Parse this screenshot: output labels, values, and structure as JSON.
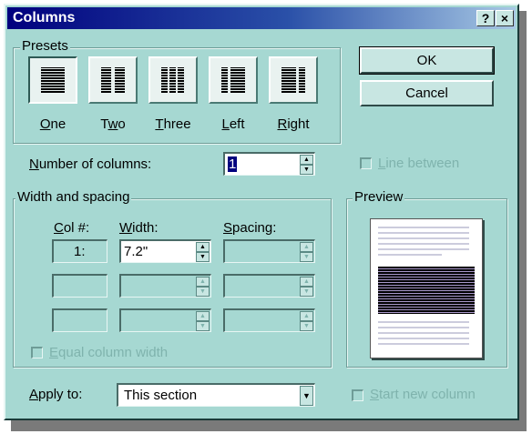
{
  "window": {
    "title": "Columns",
    "help_button": "?",
    "close_button": "×"
  },
  "presets": {
    "label": "Presets",
    "items": [
      {
        "label": "One",
        "mnemonic": "O",
        "rest": "ne"
      },
      {
        "label": "Two",
        "pre": "T",
        "mnemonic": "w",
        "rest": "o"
      },
      {
        "label": "Three",
        "mnemonic": "T",
        "rest": "hree"
      },
      {
        "label": "Left",
        "mnemonic": "L",
        "rest": "eft"
      },
      {
        "label": "Right",
        "mnemonic": "R",
        "rest": "ight"
      }
    ],
    "selected": "One"
  },
  "buttons": {
    "ok": "OK",
    "cancel": "Cancel"
  },
  "number_of_columns": {
    "label_mnemonic": "N",
    "label_rest": "umber of columns:",
    "value": "1"
  },
  "line_between": {
    "label_mnemonic": "L",
    "label_rest": "ine between",
    "checked": false,
    "enabled": false
  },
  "width_spacing": {
    "label": "Width and spacing",
    "col_header_mnemonic": "C",
    "col_header_rest": "ol #:",
    "width_header_mnemonic": "W",
    "width_header_rest": "idth:",
    "spacing_header_mnemonic": "S",
    "spacing_header_rest": "pacing:",
    "rows": [
      {
        "col": "1:",
        "width": "7.2\"",
        "spacing": ""
      },
      {
        "col": "",
        "width": "",
        "spacing": ""
      },
      {
        "col": "",
        "width": "",
        "spacing": ""
      }
    ]
  },
  "equal_column_width": {
    "label_mnemonic": "E",
    "label_rest": "qual column width",
    "checked": false,
    "enabled": false
  },
  "preview": {
    "label": "Preview"
  },
  "apply_to": {
    "label_mnemonic": "A",
    "label_rest": "pply to:",
    "value": "This section"
  },
  "start_new_column": {
    "label_mnemonic": "S",
    "label_rest": "tart new column",
    "checked": false,
    "enabled": false
  },
  "icons": [
    "help-icon",
    "close-icon",
    "spinner-up-icon",
    "spinner-down-icon",
    "dropdown-arrow-icon"
  ],
  "colors": {
    "dialog_face": "#a6d8d2",
    "title_start": "#00007e",
    "title_end": "#a7c8e4"
  }
}
